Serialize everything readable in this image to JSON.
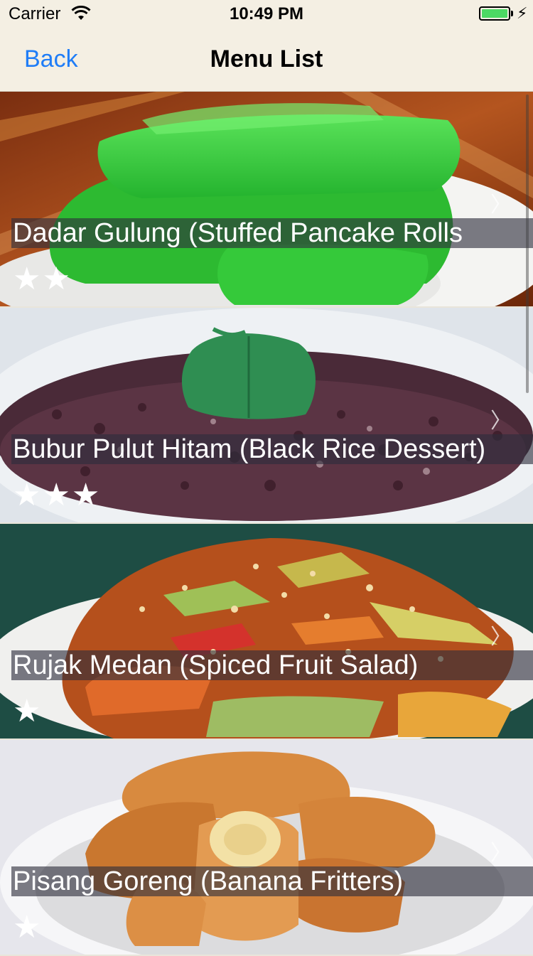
{
  "status_bar": {
    "carrier": "Carrier",
    "time": "10:49 PM",
    "battery_level": 1.0
  },
  "nav": {
    "back_label": "Back",
    "title": "Menu List"
  },
  "items": [
    {
      "title": "Dadar Gulung (Stuffed Pancake Rolls",
      "rating": 2,
      "stars": "★★"
    },
    {
      "title": "Bubur Pulut Hitam (Black Rice Dessert)",
      "rating": 3,
      "stars": "★★★"
    },
    {
      "title": "Rujak Medan (Spiced Fruit Salad)",
      "rating": 1,
      "stars": "★"
    },
    {
      "title": "Pisang Goreng (Banana Fritters)",
      "rating": 1,
      "stars": "★"
    }
  ],
  "icons": {
    "chevron": "chevron-right-icon",
    "wifi": "wifi-icon",
    "battery": "battery-icon",
    "star": "star-icon"
  },
  "colors": {
    "accent": "#1f7df7",
    "nav_background": "#f4efe3",
    "battery": "#4cd964"
  }
}
